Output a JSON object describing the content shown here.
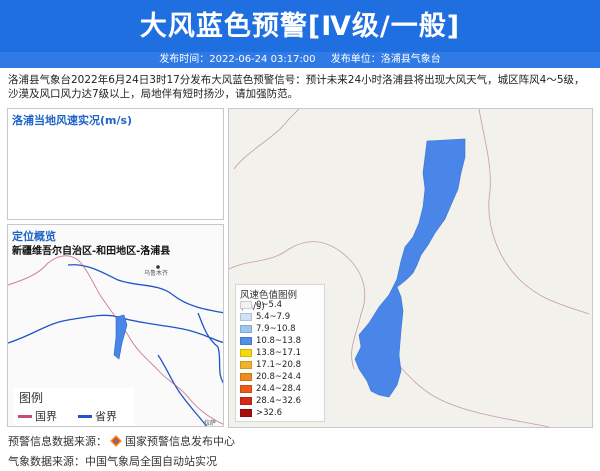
{
  "header": {
    "title": "大风蓝色预警[Ⅳ级/一般]",
    "publish_time_label": "发布时间：2022-06-24 03:17:00",
    "publisher_label": "发布单位：洛浦县气象台"
  },
  "description": "洛浦县气象台2022年6月24日3时17分发布大风蓝色预警信号：预计未来24小时洛浦县将出现大风天气，城区阵风4～5级，沙漠及风口风力达7级以上，局地伴有短时扬沙，请加强防范。",
  "wind_panel": {
    "title": "洛浦当地风速实况(m/s)"
  },
  "location_panel": {
    "title": "定位概览",
    "region": "新疆维吾尔自治区-和田地区-洛浦县",
    "map_labels": {
      "city_top": "乌鲁木齐",
      "city_bottom": "拉萨"
    },
    "legend": {
      "title": "图例",
      "items": [
        {
          "label": "国界",
          "color": "#c0506e"
        },
        {
          "label": "省界",
          "color": "#1f55c8"
        }
      ]
    }
  },
  "wind_legend": {
    "title": "风速色值图例 (m/s)",
    "items": [
      {
        "label": "0~5.4",
        "color": "#f2f2f2"
      },
      {
        "label": "5.4~7.9",
        "color": "#cfe3f5"
      },
      {
        "label": "7.9~10.8",
        "color": "#9cc8f0"
      },
      {
        "label": "10.8~13.8",
        "color": "#4f8fe8"
      },
      {
        "label": "13.8~17.1",
        "color": "#f5d90a"
      },
      {
        "label": "17.1~20.8",
        "color": "#f2b32a"
      },
      {
        "label": "20.8~24.4",
        "color": "#f08a1e"
      },
      {
        "label": "24.4~28.4",
        "color": "#ec5a18"
      },
      {
        "label": "28.4~32.6",
        "color": "#d42914"
      },
      {
        "label": ">32.6",
        "color": "#a80c0c"
      }
    ]
  },
  "colors": {
    "banner": "#1f6fe0",
    "region_fill": "#4a86e8"
  },
  "footer": {
    "source1_label": "预警信息数据来源：",
    "source1_name": "国家预警信息发布中心",
    "source2": "气象数据来源：中国气象局全国自动站实况"
  }
}
